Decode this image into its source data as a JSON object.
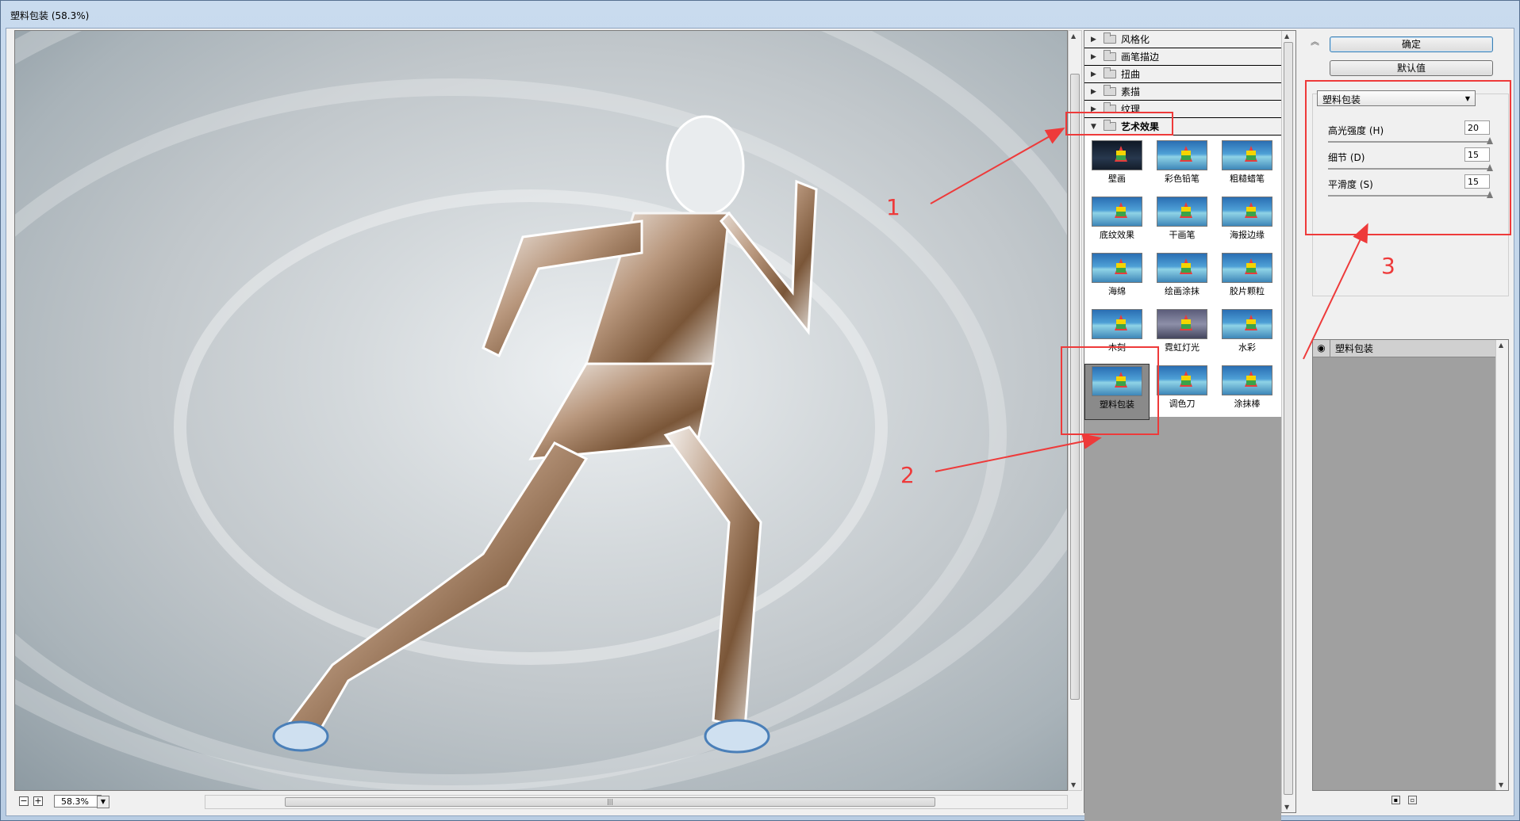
{
  "window": {
    "title": "塑料包装 (58.3%)"
  },
  "preview": {
    "zoom": "58.3%"
  },
  "gallery": {
    "folders": [
      {
        "label": "风格化",
        "open": false
      },
      {
        "label": "画笔描边",
        "open": false
      },
      {
        "label": "扭曲",
        "open": false
      },
      {
        "label": "素描",
        "open": false
      },
      {
        "label": "纹理",
        "open": false
      },
      {
        "label": "艺术效果",
        "open": true
      }
    ],
    "thumbnails": [
      "壁画",
      "彩色铅笔",
      "粗糙蜡笔",
      "底纹效果",
      "干画笔",
      "海报边缘",
      "海绵",
      "绘画涂抹",
      "胶片颗粒",
      "木刻",
      "霓虹灯光",
      "水彩",
      "塑料包装",
      "调色刀",
      "涂抹棒"
    ],
    "selected": "塑料包装"
  },
  "actions": {
    "ok_label": "确定",
    "default_label": "默认值"
  },
  "filter": {
    "name": "塑料包装",
    "params": [
      {
        "label": "高光强度 (H)",
        "value": "20",
        "fraction": 1.0
      },
      {
        "label": "细节 (D)",
        "value": "15",
        "fraction": 1.0
      },
      {
        "label": "平滑度 (S)",
        "value": "15",
        "fraction": 1.0
      }
    ]
  },
  "layers": {
    "items": [
      {
        "name": "塑料包装"
      }
    ]
  },
  "annotations": {
    "one": "1",
    "two": "2",
    "three": "3"
  },
  "colors": {
    "annotation": "#ee3a3a",
    "selected_thumb_bg": "#8a8a8a"
  }
}
